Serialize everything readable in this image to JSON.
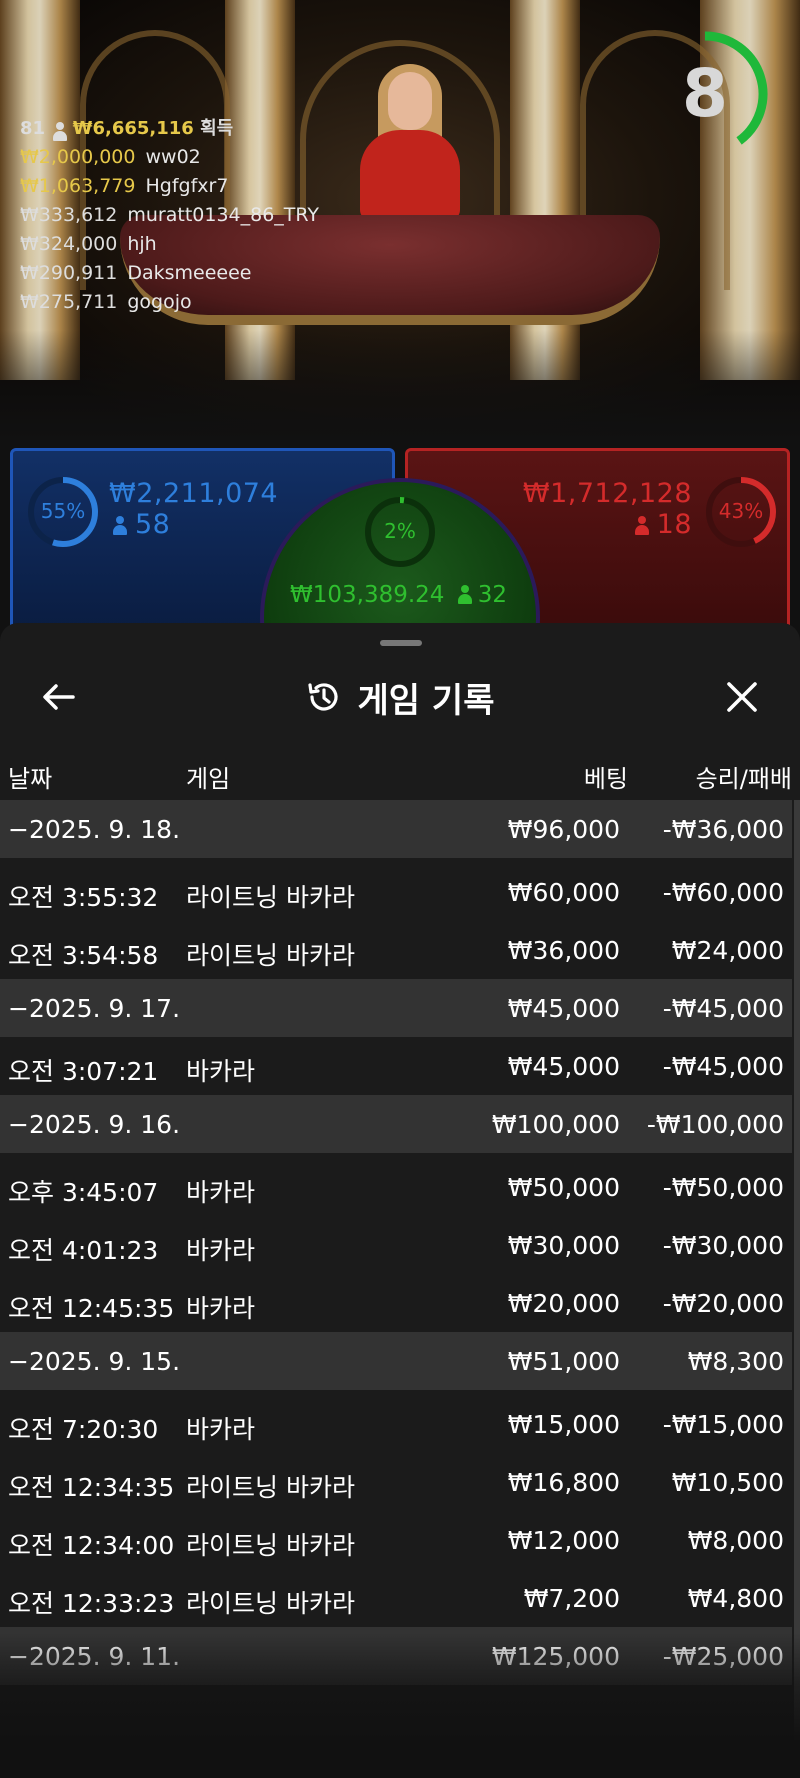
{
  "winners": {
    "count": "81",
    "total": "₩6,665,116",
    "total_label": "획득",
    "list": [
      {
        "amount": "₩2,000,000",
        "name": "ww02"
      },
      {
        "amount": "₩1,063,779",
        "name": "Hgfgfxr7"
      },
      {
        "amount": "₩333,612",
        "name": "muratt0134_86_TRY"
      },
      {
        "amount": "₩324,000",
        "name": "hjh"
      },
      {
        "amount": "₩290,911",
        "name": "Daksmeeeee"
      },
      {
        "amount": "₩275,711",
        "name": "gogojo"
      }
    ]
  },
  "timer": {
    "value": "8",
    "fraction": 0.4,
    "color": "#1fb83a"
  },
  "betting": {
    "player": {
      "percent": "55%",
      "percent_value": 0.55,
      "amount": "₩2,211,074",
      "players": "58",
      "color": "#2e7fdc"
    },
    "banker": {
      "percent": "43%",
      "percent_value": 0.43,
      "amount": "₩1,712,128",
      "players": "18",
      "color": "#d42b2b"
    },
    "tie": {
      "percent": "2%",
      "percent_value": 0.02,
      "amount": "₩103,389.24",
      "players": "32",
      "color": "#2fbf2f"
    }
  },
  "history": {
    "title": "게임 기록",
    "columns": {
      "date": "날짜",
      "game": "게임",
      "bet": "베팅",
      "result": "승리/패배"
    },
    "rows": [
      {
        "type": "date",
        "date": "−2025. 9. 18.",
        "bet": "₩96,000",
        "result": "-₩36,000"
      },
      {
        "type": "game",
        "time": "오전 3:55:32",
        "game": "라이트닝 바카라",
        "bet": "₩60,000",
        "result": "-₩60,000"
      },
      {
        "type": "game",
        "time": "오전 3:54:58",
        "game": "라이트닝 바카라",
        "bet": "₩36,000",
        "result": "₩24,000"
      },
      {
        "type": "date",
        "date": "−2025. 9. 17.",
        "bet": "₩45,000",
        "result": "-₩45,000"
      },
      {
        "type": "game",
        "time": "오전 3:07:21",
        "game": "바카라",
        "bet": "₩45,000",
        "result": "-₩45,000"
      },
      {
        "type": "date",
        "date": "−2025. 9. 16.",
        "bet": "₩100,000",
        "result": "-₩100,000"
      },
      {
        "type": "game",
        "time": "오후 3:45:07",
        "game": "바카라",
        "bet": "₩50,000",
        "result": "-₩50,000"
      },
      {
        "type": "game",
        "time": "오전 4:01:23",
        "game": "바카라",
        "bet": "₩30,000",
        "result": "-₩30,000"
      },
      {
        "type": "game",
        "time": "오전 12:45:35",
        "game": "바카라",
        "bet": "₩20,000",
        "result": "-₩20,000"
      },
      {
        "type": "date",
        "date": "−2025. 9. 15.",
        "bet": "₩51,000",
        "result": "₩8,300"
      },
      {
        "type": "game",
        "time": "오전 7:20:30",
        "game": "바카라",
        "bet": "₩15,000",
        "result": "-₩15,000"
      },
      {
        "type": "game",
        "time": "오전 12:34:35",
        "game": "라이트닝 바카라",
        "bet": "₩16,800",
        "result": "₩10,500"
      },
      {
        "type": "game",
        "time": "오전 12:34:00",
        "game": "라이트닝 바카라",
        "bet": "₩12,000",
        "result": "₩8,000"
      },
      {
        "type": "game",
        "time": "오전 12:33:23",
        "game": "라이트닝 바카라",
        "bet": "₩7,200",
        "result": "₩4,800"
      },
      {
        "type": "date",
        "date": "−2025. 9. 11.",
        "bet": "₩125,000",
        "result": "-₩25,000"
      }
    ]
  },
  "icons": {
    "back": "arrow-left-icon",
    "history": "history-clock-icon",
    "close": "close-icon",
    "person": "person-icon"
  }
}
